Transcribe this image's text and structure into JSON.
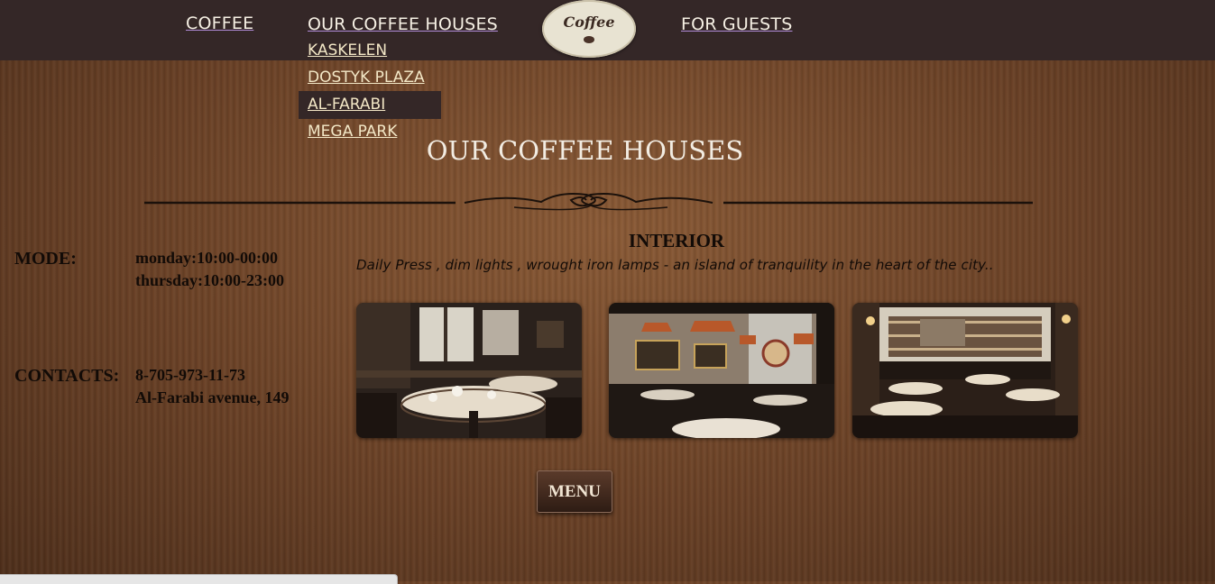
{
  "nav": {
    "coffee": "COFFEE",
    "coffee_houses": "OUR COFFEE HOUSES",
    "for_guests": "FOR GUESTS"
  },
  "dropdown": {
    "items": [
      "KASKELEN",
      "DOSTYK PLAZA",
      "AL-FARABI",
      "MEGA PARK"
    ],
    "active_item": "AL-FARABI"
  },
  "logo": {
    "text": "Coffee"
  },
  "page": {
    "title": "OUR COFFEE HOUSES"
  },
  "info": {
    "mode_label": "MODE:",
    "mode_lines": [
      "monday:10:00-00:00",
      "thursday:10:00-23:00"
    ],
    "contacts_label": "CONTACTS:",
    "contacts_lines": [
      "8-705-973-11-73",
      "Al-Farabi avenue, 149"
    ]
  },
  "interior": {
    "title": "INTERIOR",
    "description": "Daily Press , dim lights , wrought iron lamps - an island of tranquility in the heart of the city.."
  },
  "menu_button": {
    "label": "MENU"
  },
  "colors": {
    "topbar": "#342727",
    "nav_text": "#f6f0e4",
    "dropdown_text": "#f3e7c6",
    "body_text": "#120b07",
    "wood": "#6e4428"
  }
}
